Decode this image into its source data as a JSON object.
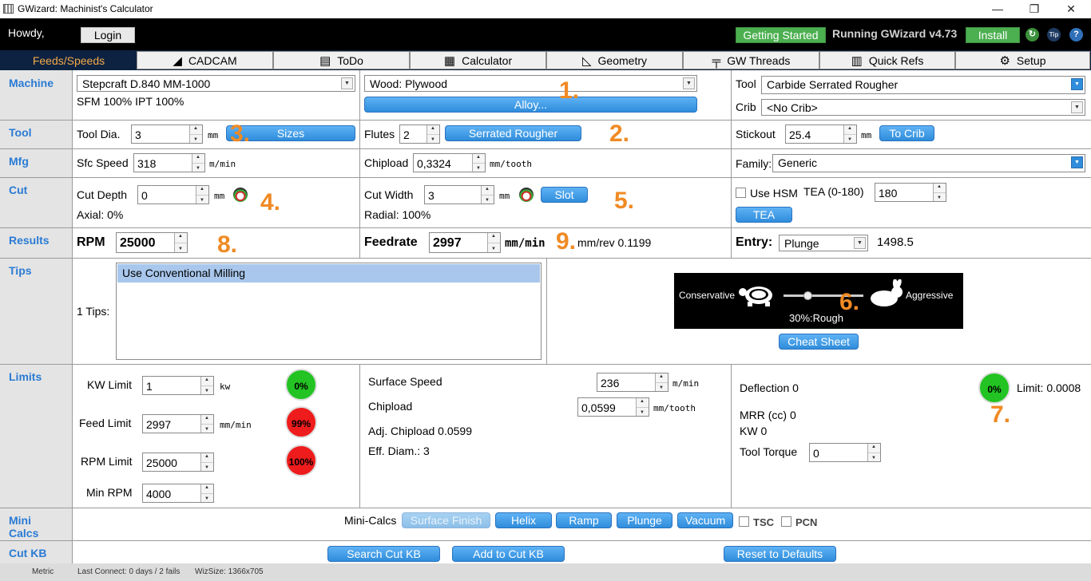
{
  "window": {
    "title": "GWizard: Machinist's Calculator"
  },
  "topbar": {
    "greeting": "Howdy,",
    "login": "Login",
    "getting_started": "Getting Started",
    "running": "Running GWizard v4.73",
    "install": "Install",
    "tip": "Tip",
    "help": "?"
  },
  "tabs": [
    {
      "label": "Feeds/Speeds",
      "icon": ""
    },
    {
      "label": "CADCAM",
      "icon": "◢"
    },
    {
      "label": "ToDo",
      "icon": "▤"
    },
    {
      "label": "Calculator",
      "icon": "▦"
    },
    {
      "label": "Geometry",
      "icon": "◺"
    },
    {
      "label": "GW Threads",
      "icon": "╤"
    },
    {
      "label": "Quick Refs",
      "icon": "▥"
    },
    {
      "label": "Setup",
      "icon": "⚙"
    }
  ],
  "sections": {
    "machine": "Machine",
    "tool": "Tool",
    "mfg": "Mfg",
    "cut": "Cut",
    "results": "Results",
    "tips": "Tips",
    "limits": "Limits",
    "mini_calcs": "Mini\nCalcs",
    "cut_kb": "Cut KB"
  },
  "machine": {
    "machine_value": "Stepcraft D.840 MM-1000",
    "sfm_ipt": "SFM 100% IPT 100%",
    "material_value": "Wood: Plywood",
    "alloy": "Alloy...",
    "tool_label": "Tool",
    "tool_value": "Carbide Serrated Rougher",
    "crib_label": "Crib",
    "crib_value": "<No Crib>"
  },
  "tool": {
    "dia_label": "Tool Dia.",
    "dia_value": "3",
    "dia_unit": "mm",
    "sizes": "Sizes",
    "flutes_label": "Flutes",
    "flutes_value": "2",
    "serrated": "Serrated Rougher",
    "stickout_label": "Stickout",
    "stickout_value": "25.4",
    "stickout_unit": "mm",
    "to_crib": "To Crib"
  },
  "mfg": {
    "sfc_label": "Sfc Speed",
    "sfc_value": "318",
    "sfc_unit": "m/min",
    "chipload_label": "Chipload",
    "chipload_value": "0,3324",
    "chipload_unit": "mm/tooth",
    "family_label": "Family:",
    "family_value": "Generic"
  },
  "cut": {
    "depth_label": "Cut Depth",
    "depth_value": "0",
    "depth_unit": "mm",
    "axial": "Axial: 0%",
    "width_label": "Cut Width",
    "width_value": "3",
    "width_unit": "mm",
    "slot": "Slot",
    "radial": "Radial: 100%",
    "use_hsm": "Use HSM",
    "tea_label": "TEA (0-180)",
    "tea_value": "180",
    "tea_btn": "TEA"
  },
  "results": {
    "rpm_label": "RPM",
    "rpm_value": "25000",
    "feed_label": "Feedrate",
    "feed_value": "2997",
    "feed_unit": "mm/min",
    "mmrev": "mm/rev 0.1199",
    "entry_label": "Entry:",
    "entry_value": "Plunge",
    "entry_number": "1498.5"
  },
  "tips": {
    "count_label": "1 Tips:",
    "items": [
      "Use Conventional Milling"
    ],
    "conservative": "Conservative",
    "aggressive": "Aggressive",
    "slider_percent": 0.3,
    "mode": "30%:Rough",
    "cheat_sheet": "Cheat Sheet"
  },
  "limits": {
    "kw_label": "KW Limit",
    "kw_value": "1",
    "kw_unit": "kw",
    "kw_pct": "0%",
    "feed_label": "Feed Limit",
    "feed_value": "2997",
    "feed_unit": "mm/min",
    "feed_pct": "99%",
    "rpm_label": "RPM Limit",
    "rpm_value": "25000",
    "rpm_pct": "100%",
    "minrpm_label": "Min RPM",
    "minrpm_value": "4000",
    "ss_label": "Surface Speed",
    "ss_value": "236",
    "ss_unit": "m/min",
    "cl_label": "Chipload",
    "cl_value": "0,0599",
    "cl_unit": "mm/tooth",
    "adj": "Adj. Chipload 0.0599",
    "eff": "Eff. Diam.: 3",
    "deflection": "Deflection 0",
    "defl_pct": "0%",
    "limit": "Limit: 0.0008",
    "mrr": "MRR (cc) 0",
    "kw": "KW 0",
    "torque_label": "Tool Torque",
    "torque_value": "0"
  },
  "minicalcs": {
    "label": "Mini-Calcs",
    "surface_finish": "Surface Finish",
    "helix": "Helix",
    "ramp": "Ramp",
    "plunge": "Plunge",
    "vacuum": "Vacuum",
    "tsc": "TSC",
    "pcn": "PCN"
  },
  "cutkb": {
    "search": "Search Cut KB",
    "add": "Add to Cut KB",
    "reset": "Reset to Defaults"
  },
  "annotations": [
    "1.",
    "2.",
    "3.",
    "4.",
    "5.",
    "6.",
    "7.",
    "8.",
    "9."
  ],
  "status": {
    "metric": "Metric",
    "last": "Last Connect: 0 days / 2 fails",
    "wiz": "WizSize: 1366x705"
  },
  "colors": {
    "accent": "#2a7bd4",
    "green": "#22c322",
    "red": "#ee1c1c",
    "annotation": "#f08a24",
    "tab_bg": "#0d2240"
  }
}
